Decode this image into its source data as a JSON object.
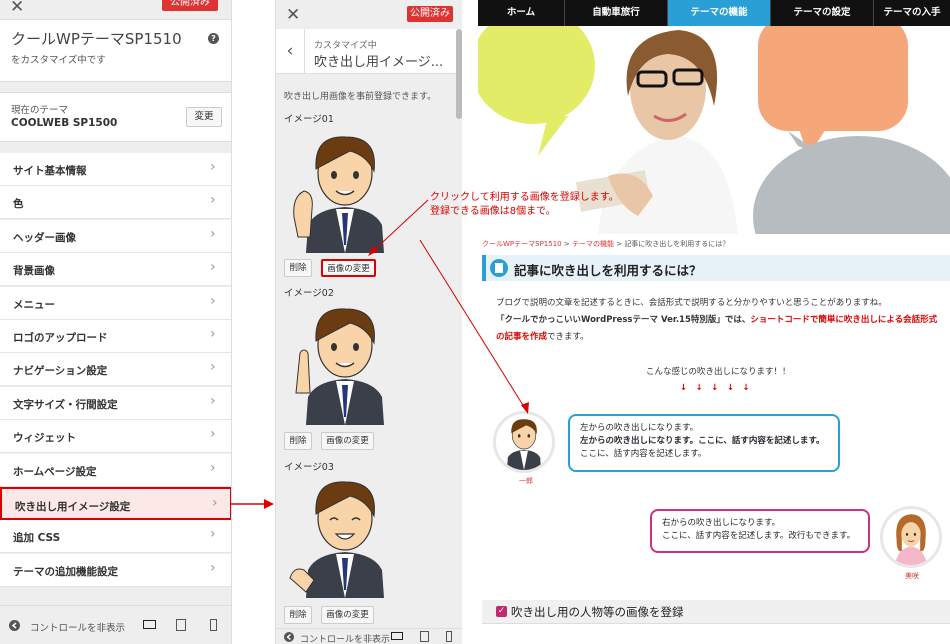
{
  "left_panel": {
    "close_label": "✕",
    "publish_label": "公開済み",
    "title": "クールWPテーマSP1510",
    "subtitle": "をカスタマイズ中です",
    "current_theme_label": "現在のテーマ",
    "current_theme_name": "COOLWEB SP1500",
    "change_button": "変更",
    "menu_items": [
      {
        "label": "サイト基本情報"
      },
      {
        "label": "色"
      },
      {
        "label": "ヘッダー画像"
      },
      {
        "label": "背景画像"
      },
      {
        "label": "メニュー"
      },
      {
        "label": "ロゴのアップロード"
      },
      {
        "label": "ナビゲーション設定"
      },
      {
        "label": "文字サイズ・行間設定"
      },
      {
        "label": "ウィジェット"
      },
      {
        "label": "ホームページ設定"
      },
      {
        "label": "吹き出し用イメージ設定"
      },
      {
        "label": "追加 CSS"
      },
      {
        "label": "テーマの追加機能設定"
      }
    ],
    "footer_text": "コントロールを非表示"
  },
  "mid_panel": {
    "close_label": "✕",
    "publish_label": "公開済み",
    "header_sub": "カスタマイズ中",
    "header_title": "吹き出し用イメージ...",
    "intro": "吹き出し用画像を事前登録できます。",
    "images": [
      {
        "label": "イメージ01",
        "delete": "削除",
        "change": "画像の変更"
      },
      {
        "label": "イメージ02",
        "delete": "削除",
        "change": "画像の変更"
      },
      {
        "label": "イメージ03",
        "delete": "削除",
        "change": "画像の変更"
      }
    ],
    "footer_text": "コントロールを非表示"
  },
  "annotation": {
    "line1": "クリックして利用する画像を登録します。",
    "line2": "登録できる画像は8個まで。"
  },
  "preview": {
    "nav": [
      "ホーム",
      "自動車旅行",
      "テーマの機能",
      "テーマの設定",
      "テーマの入手"
    ],
    "breadcrumb_home": "クールWPテーマSP1510",
    "breadcrumb_sep1": ">",
    "breadcrumb_cat": "テーマの機能",
    "breadcrumb_sep2": ">",
    "breadcrumb_page": "記事に吹き出しを利用するには？",
    "heading": "記事に吹き出しを利用するには？",
    "para1": "ブログで説明の文章を記述するときに、会話形式で説明すると分かりやすいと思うことがありますね。",
    "para2a": "「クールでかっこいいWordPressテーマ Ver.15特別版」では、",
    "para2b": "ショートコードで簡単に吹き出しによる会話形式",
    "para3a": "の記事を作成",
    "para3b": "できます。",
    "example_intro": "こんな感じの吹き出しになります！！",
    "arrows": "↓　↓　↓　↓　↓",
    "left_bubble": [
      "左からの吹き出しになります。",
      "左からの吹き出しになります。ここに、話す内容を記述します。",
      "ここに、話す内容を記述します。"
    ],
    "left_name": "一郎",
    "right_bubble": [
      "右からの吹き出しになります。",
      "ここに、話す内容を記述します。改行もできます。"
    ],
    "right_name": "美咲",
    "h3": "吹き出し用の人物等の画像を登録"
  },
  "colors": {
    "accent_red": "#d33",
    "nav_active": "#2a9fd6",
    "bubble_left_border": "#2a9fd6",
    "bubble_right_border": "#d02f7a"
  }
}
